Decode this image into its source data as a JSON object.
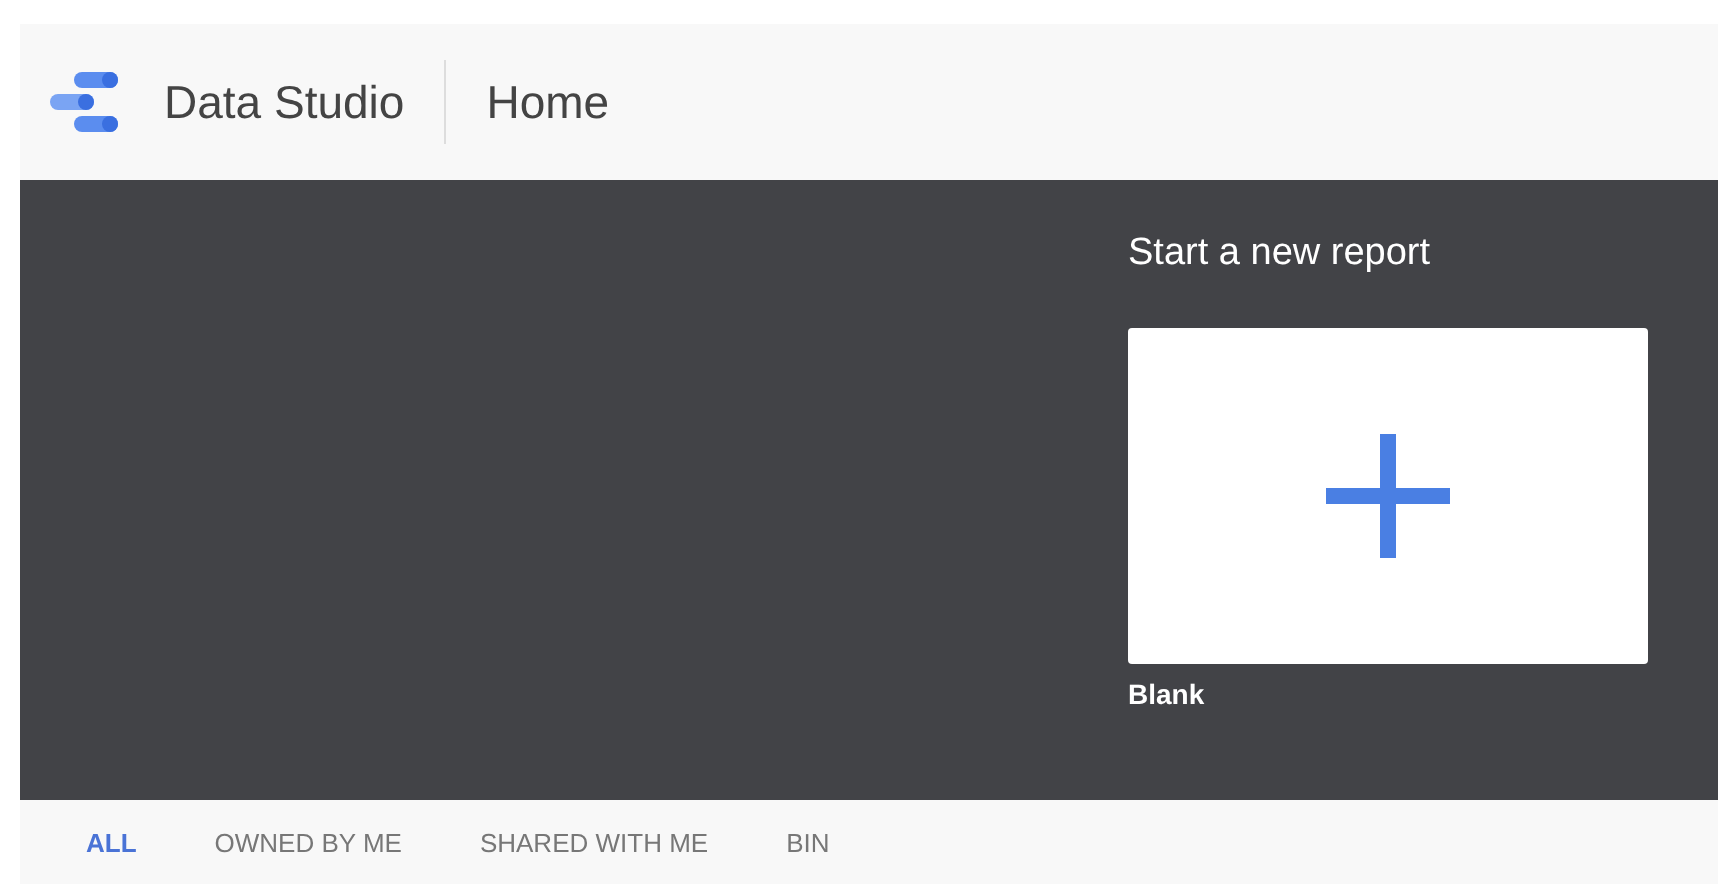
{
  "header": {
    "product": "Data Studio",
    "page": "Home"
  },
  "hero": {
    "title": "Start a new report",
    "templates": [
      {
        "label": "Blank",
        "kind": "blank"
      }
    ]
  },
  "tabs": [
    {
      "label": "ALL",
      "selected": true
    },
    {
      "label": "OWNED BY ME",
      "selected": false
    },
    {
      "label": "SHARED WITH ME",
      "selected": false
    },
    {
      "label": "BIN",
      "selected": false
    }
  ]
}
